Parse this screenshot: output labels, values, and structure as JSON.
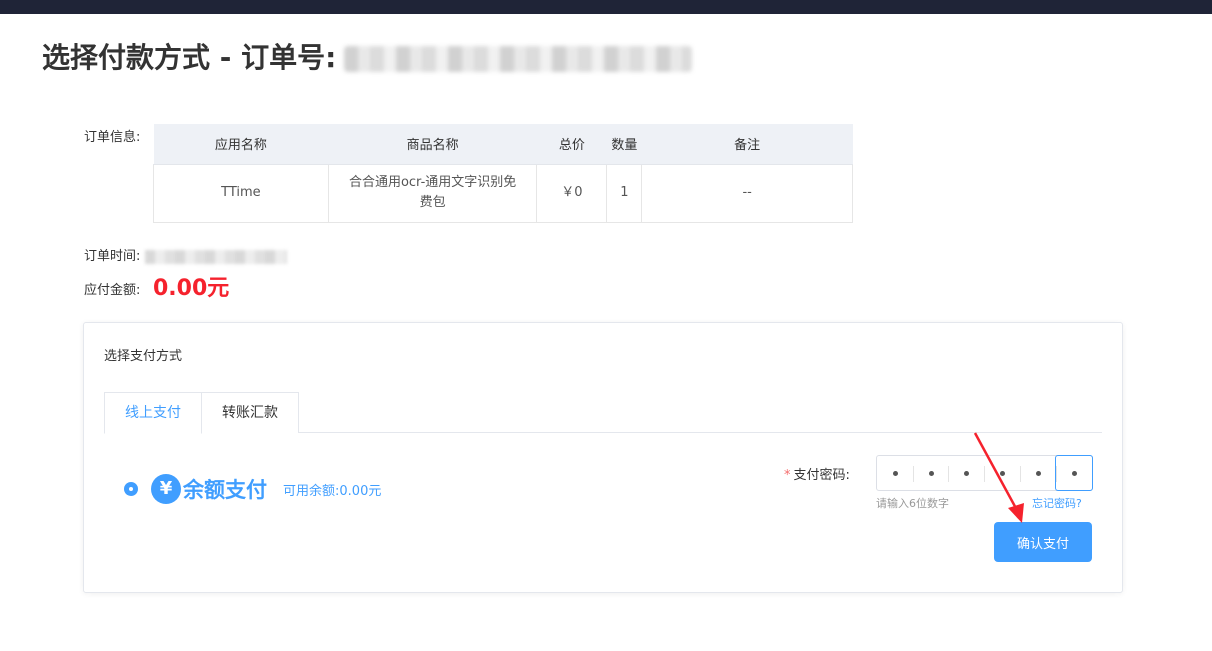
{
  "page": {
    "title": "选择付款方式 - 订单号:"
  },
  "order_info": {
    "label": "订单信息:",
    "columns": [
      "应用名称",
      "商品名称",
      "总价",
      "数量",
      "备注"
    ],
    "rows": [
      [
        "TTime",
        "合合通用ocr-通用文字识别免费包",
        "￥0",
        "1",
        "--"
      ]
    ]
  },
  "order_time": {
    "label": "订单时间:"
  },
  "amount_due": {
    "label": "应付金额:",
    "value": "0.00元"
  },
  "payment": {
    "title": "选择支付方式",
    "tabs": [
      {
        "label": "线上支付",
        "active": true
      },
      {
        "label": "转账汇款",
        "active": false
      }
    ],
    "method": {
      "icon": "yen-icon",
      "icon_glyph": "¥",
      "name": "余额支付",
      "balance_label": "可用余额:",
      "balance_value": "0.00元",
      "selected": true
    },
    "password": {
      "required_mark": "*",
      "label": "支付密码:",
      "length": 6,
      "filled": 6,
      "hint": "请输入6位数字",
      "forgot_label": "忘记密码?"
    },
    "confirm_label": "确认支付"
  },
  "colors": {
    "accent": "#409eff",
    "amount": "#f5222d",
    "topbar": "#1f2437",
    "arrow": "#f5222d"
  }
}
